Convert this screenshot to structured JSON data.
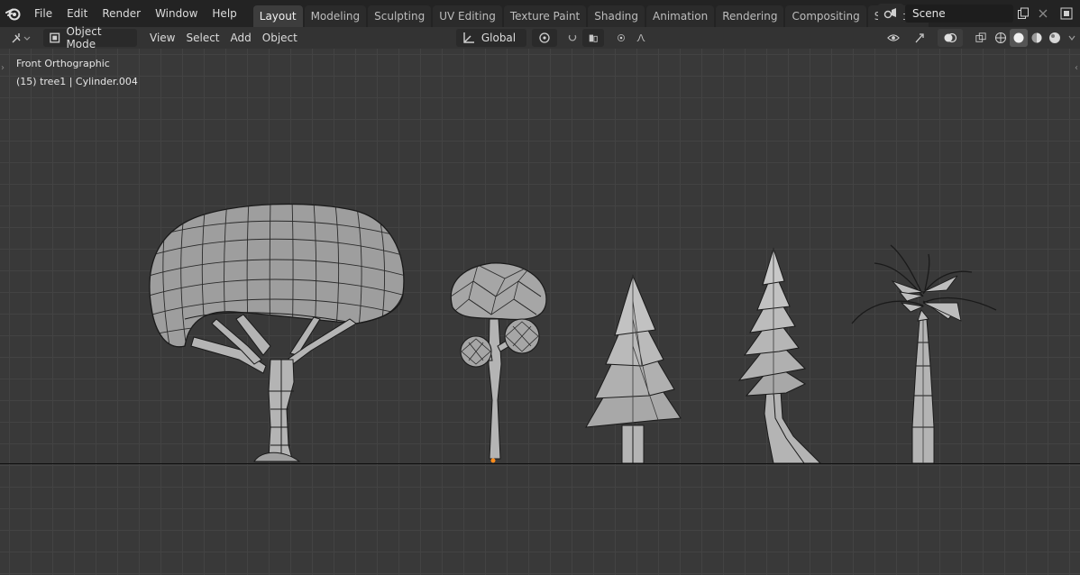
{
  "topbar": {
    "menu": [
      "File",
      "Edit",
      "Render",
      "Window",
      "Help"
    ],
    "tabs": [
      {
        "label": "Layout",
        "active": true
      },
      {
        "label": "Modeling",
        "active": false
      },
      {
        "label": "Sculpting",
        "active": false
      },
      {
        "label": "UV Editing",
        "active": false
      },
      {
        "label": "Texture Paint",
        "active": false
      },
      {
        "label": "Shading",
        "active": false
      },
      {
        "label": "Animation",
        "active": false
      },
      {
        "label": "Rendering",
        "active": false
      },
      {
        "label": "Compositing",
        "active": false
      },
      {
        "label": "Scripting",
        "active": false
      }
    ],
    "add_tab": "+",
    "scene_name": "Scene"
  },
  "header": {
    "mode": "Object Mode",
    "menus": [
      "View",
      "Select",
      "Add",
      "Object"
    ],
    "transform_orientation": "Global"
  },
  "viewport": {
    "view_name": "Front Orthographic",
    "object_info": "(15) tree1 | Cylinder.004"
  },
  "colors": {
    "accent": "#4772b3",
    "origin_dot": "#ff8c1a",
    "mesh_fill": "#a9a9a9",
    "mesh_edge": "#1a1a1a"
  },
  "icons": {
    "logo": "blender-logo-icon",
    "scene": "scene-icon",
    "new_scene": "copy-icon",
    "remove_scene": "close-icon",
    "view_layer": "view-layer-icon"
  }
}
